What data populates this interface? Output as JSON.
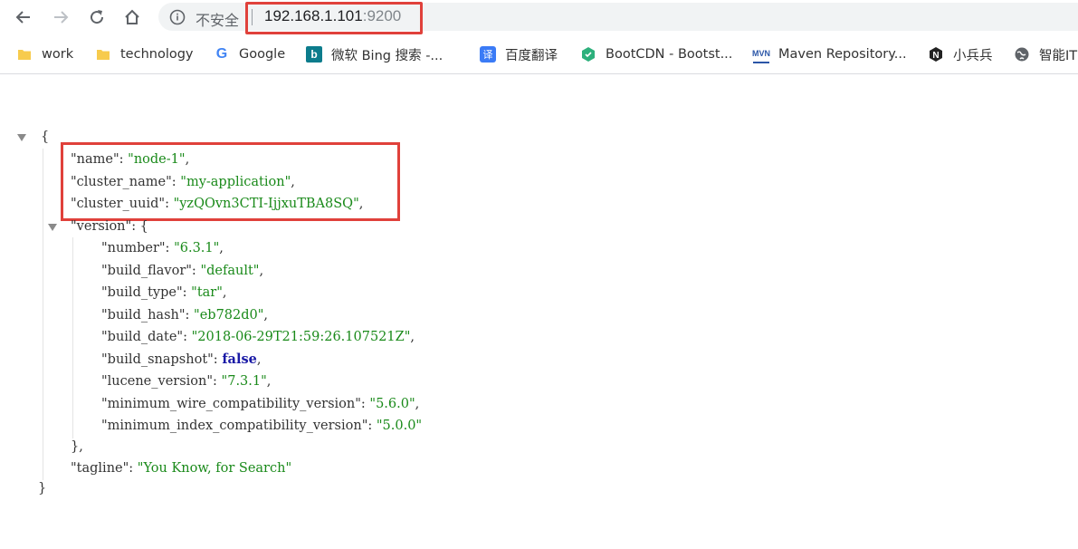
{
  "address_bar": {
    "security_label": "不安全",
    "url_host": "192.168.1.101",
    "url_port": ":9200"
  },
  "bookmarks": [
    {
      "label": "work",
      "icon": "folder-icon"
    },
    {
      "label": "technology",
      "icon": "folder-icon"
    },
    {
      "label": "Google",
      "icon": "google-icon"
    },
    {
      "label": "微软 Bing 搜索 -...",
      "icon": "bing-icon"
    },
    {
      "label": "百度翻译",
      "icon": "baidu-translate-icon"
    },
    {
      "label": "BootCDN - Bootst...",
      "icon": "bootcdn-icon"
    },
    {
      "label": "Maven Repository...",
      "icon": "maven-icon"
    },
    {
      "label": "小兵兵",
      "icon": "n-icon"
    },
    {
      "label": "智能IT",
      "icon": "globe-icon"
    }
  ],
  "json": {
    "open_brace": "{",
    "close_brace": "}",
    "name_key": "\"name\": ",
    "name_val": "\"node-1\"",
    "cluster_name_key": "\"cluster_name\": ",
    "cluster_name_val": "\"my-application\"",
    "cluster_uuid_key": "\"cluster_uuid\": ",
    "cluster_uuid_val": "\"yzQOvn3CTI-IjjxuTBA8SQ\"",
    "version_key": "\"version\": {",
    "number_key": "\"number\": ",
    "number_val": "\"6.3.1\"",
    "build_flavor_key": "\"build_flavor\": ",
    "build_flavor_val": "\"default\"",
    "build_type_key": "\"build_type\": ",
    "build_type_val": "\"tar\"",
    "build_hash_key": "\"build_hash\": ",
    "build_hash_val": "\"eb782d0\"",
    "build_date_key": "\"build_date\": ",
    "build_date_val": "\"2018-06-29T21:59:26.107521Z\"",
    "build_snapshot_key": "\"build_snapshot\": ",
    "build_snapshot_val": "false",
    "lucene_version_key": "\"lucene_version\": ",
    "lucene_version_val": "\"7.3.1\"",
    "min_wire_key": "\"minimum_wire_compatibility_version\": ",
    "min_wire_val": "\"5.6.0\"",
    "min_index_key": "\"minimum_index_compatibility_version\": ",
    "min_index_val": "\"5.0.0\"",
    "version_close": "},",
    "tagline_key": "\"tagline\": ",
    "tagline_val": "\"You Know, for Search\"",
    "comma": ","
  },
  "colors": {
    "string": "#1a8a1a",
    "boolean": "#1a1aa6",
    "highlight": "#e0413b"
  }
}
